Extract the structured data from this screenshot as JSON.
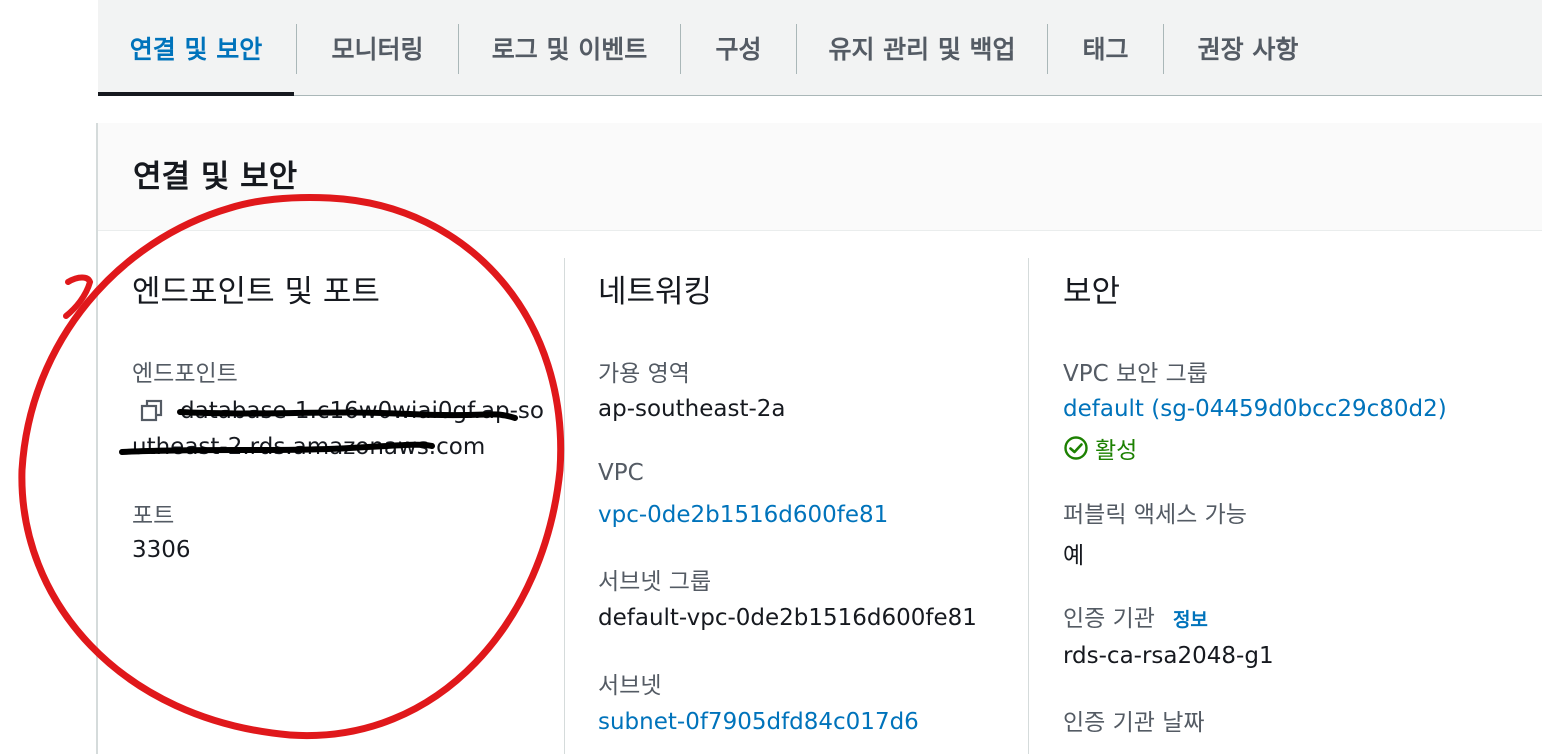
{
  "tabs": [
    {
      "label": "연결 및 보안",
      "active": true
    },
    {
      "label": "모니터링"
    },
    {
      "label": "로그 및 이벤트"
    },
    {
      "label": "구성"
    },
    {
      "label": "유지 관리 및 백업"
    },
    {
      "label": "태그"
    },
    {
      "label": "권장 사항"
    }
  ],
  "section_title": "연결 및 보안",
  "endpoints": {
    "heading": "엔드포인트 및 포트",
    "endpoint_label": "엔드포인트",
    "endpoint_line1": "database-1.c16w0wiai0gf.ap-so",
    "endpoint_line2": "utheast-2.rds.amazonaws.com",
    "port_label": "포트",
    "port_value": "3306"
  },
  "networking": {
    "heading": "네트워킹",
    "az_label": "가용 영역",
    "az_value": "ap-southeast-2a",
    "vpc_label": "VPC",
    "vpc_value": "vpc-0de2b1516d600fe81",
    "subnet_group_label": "서브넷 그룹",
    "subnet_group_value": "default-vpc-0de2b1516d600fe81",
    "subnet_label": "서브넷",
    "subnet_value": "subnet-0f7905dfd84c017d6"
  },
  "security": {
    "heading": "보안",
    "sg_label": "VPC 보안 그룹",
    "sg_value": "default (sg-04459d0bcc29c80d2)",
    "sg_status": "활성",
    "public_label": "퍼블릭 액세스 가능",
    "public_value": "예",
    "ca_label": "인증 기관",
    "ca_info": "정보",
    "ca_value": "rds-ca-rsa2048-g1",
    "ca_date_label": "인증 기관 날짜"
  },
  "colors": {
    "link": "#0073bb",
    "active_status": "#1d8102",
    "annotation": "#e0181b"
  }
}
